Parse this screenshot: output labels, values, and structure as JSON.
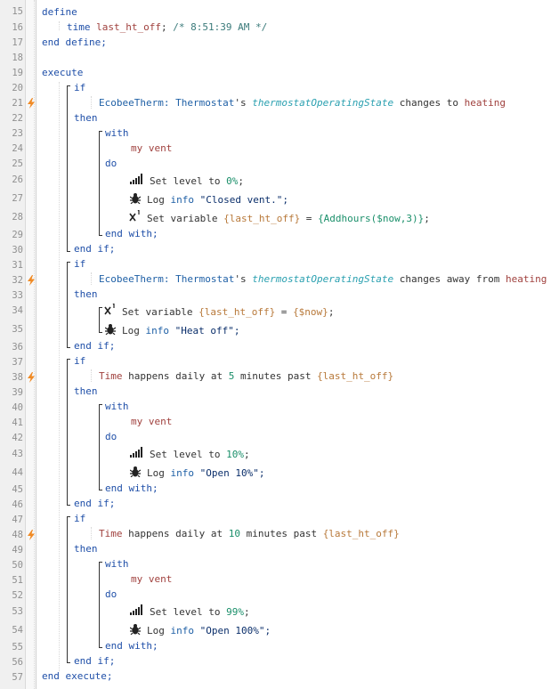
{
  "line_numbers": [
    15,
    16,
    17,
    18,
    19,
    20,
    21,
    22,
    23,
    24,
    25,
    26,
    27,
    28,
    29,
    30,
    31,
    32,
    33,
    34,
    35,
    36,
    37,
    38,
    39,
    40,
    41,
    42,
    43,
    44,
    45,
    46,
    47,
    48,
    49,
    50,
    51,
    52,
    53,
    54,
    55,
    56,
    57
  ],
  "trigger_lines": [
    21,
    32,
    38,
    48
  ],
  "kw": {
    "define": "define",
    "time": "time",
    "end_define": "end define;",
    "execute": "execute",
    "if": "if",
    "then": "then",
    "with": "with",
    "do": "do",
    "end_with": "end with;",
    "end_if": "end if;",
    "end_execute": "end execute;"
  },
  "define": {
    "var_name": "last_ht_off",
    "semicolon": ";",
    "comment": " /* 8:51:39 AM */"
  },
  "blocks": {
    "b1": {
      "device": "EcobeeTherm: Thermostat",
      "possessive": "'s",
      "attribute": "thermostatOperatingState",
      "op": "changes to",
      "value": "heating",
      "vent": "my vent",
      "set_level_prefix": "Set level to ",
      "set_level_value": "0%",
      "set_level_suffix": ";",
      "log_prefix": "Log ",
      "log_level": "info",
      "log_msg": " \"Closed vent.\";",
      "setvar_prefix": "Set variable ",
      "setvar_name": "{last_ht_off}",
      "setvar_eq": " = ",
      "setvar_expr": "{Addhours($now,3)}",
      "setvar_suffix": ";"
    },
    "b2": {
      "device": "EcobeeTherm: Thermostat",
      "possessive": "'s",
      "attribute": "thermostatOperatingState",
      "op": "changes away from",
      "value": "heating",
      "setvar_prefix": "Set variable ",
      "setvar_name": "{last_ht_off}",
      "setvar_eq": " = ",
      "setvar_expr": "{$now}",
      "setvar_suffix": ";",
      "log_prefix": "Log ",
      "log_level": "info",
      "log_msg": " \"Heat off\";"
    },
    "b3": {
      "subject": "Time",
      "text1": " happens daily at ",
      "minutes": "5",
      "text2": " minutes past ",
      "var": "{last_ht_off}",
      "vent": "my vent",
      "set_level_prefix": "Set level to ",
      "set_level_value": "10%",
      "set_level_suffix": ";",
      "log_prefix": "Log ",
      "log_level": "info",
      "log_msg": " \"Open 10%\";"
    },
    "b4": {
      "subject": "Time",
      "text1": " happens daily at ",
      "minutes": "10",
      "text2": " minutes past ",
      "var": "{last_ht_off}",
      "vent": "my vent",
      "set_level_prefix": "Set level to ",
      "set_level_value": "99%",
      "set_level_suffix": ";",
      "log_prefix": "Log ",
      "log_level": "info",
      "log_msg": " \"Open 100%\";"
    }
  },
  "colors": {
    "keyword": "#1f4fa8",
    "attribute": "#2aa0b0",
    "value": "#a0413e",
    "number": "#1a8f6a",
    "variable": "#b8793a",
    "trigger_bolt": "#f08a24"
  }
}
